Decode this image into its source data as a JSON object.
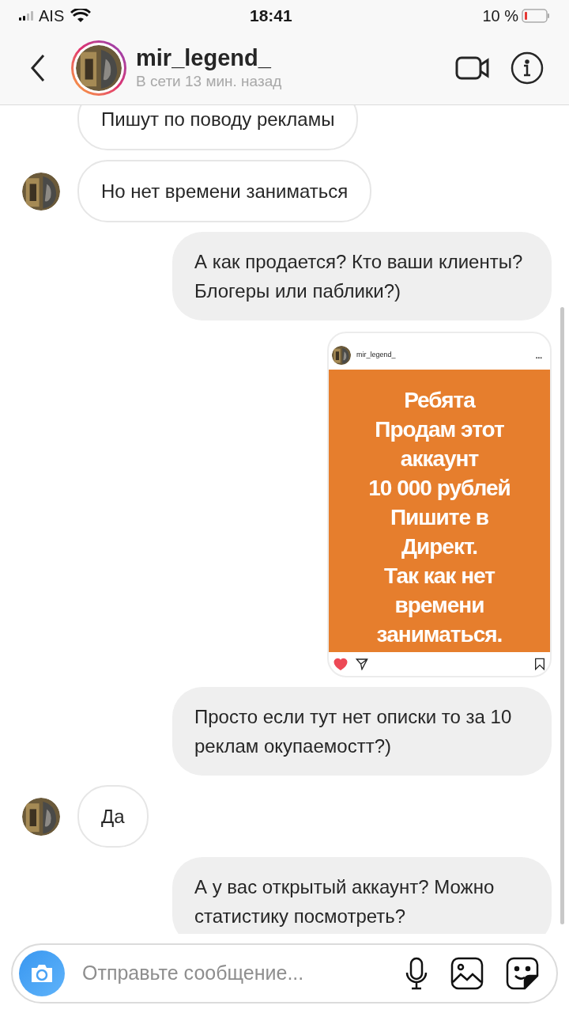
{
  "status_bar": {
    "carrier": "AIS",
    "time": "18:41",
    "battery": "10 %"
  },
  "header": {
    "username": "mir_legend_",
    "status": "В сети 13 мин. назад"
  },
  "messages": [
    {
      "kind": "text",
      "outgoing": false,
      "avatar": false,
      "text": "Пишут по поводу рекламы"
    },
    {
      "kind": "text",
      "outgoing": false,
      "avatar": true,
      "text": "Но нет времени заниматься"
    },
    {
      "kind": "text",
      "outgoing": true,
      "text": "А как продается? Кто ваши клиенты? Блогеры или паблики?)"
    },
    {
      "kind": "post",
      "outgoing": true,
      "username": "mir_legend_",
      "more": "...",
      "lines": [
        "Ребята",
        "Продам этот",
        "аккаунт",
        "10 000 рублей",
        "Пишите в",
        "Директ.",
        "Так как нет",
        "времени",
        "заниматься."
      ],
      "liked": true
    },
    {
      "kind": "text",
      "outgoing": true,
      "text": "Просто если тут нет описки то за 10 реклам окупаемостт?)"
    },
    {
      "kind": "text",
      "outgoing": false,
      "avatar": true,
      "text": "Да"
    },
    {
      "kind": "text",
      "outgoing": true,
      "text": "А у вас открытый аккаунт? Можно статистику посмотреть?"
    }
  ],
  "composer": {
    "placeholder": "Отправьте сообщение..."
  }
}
